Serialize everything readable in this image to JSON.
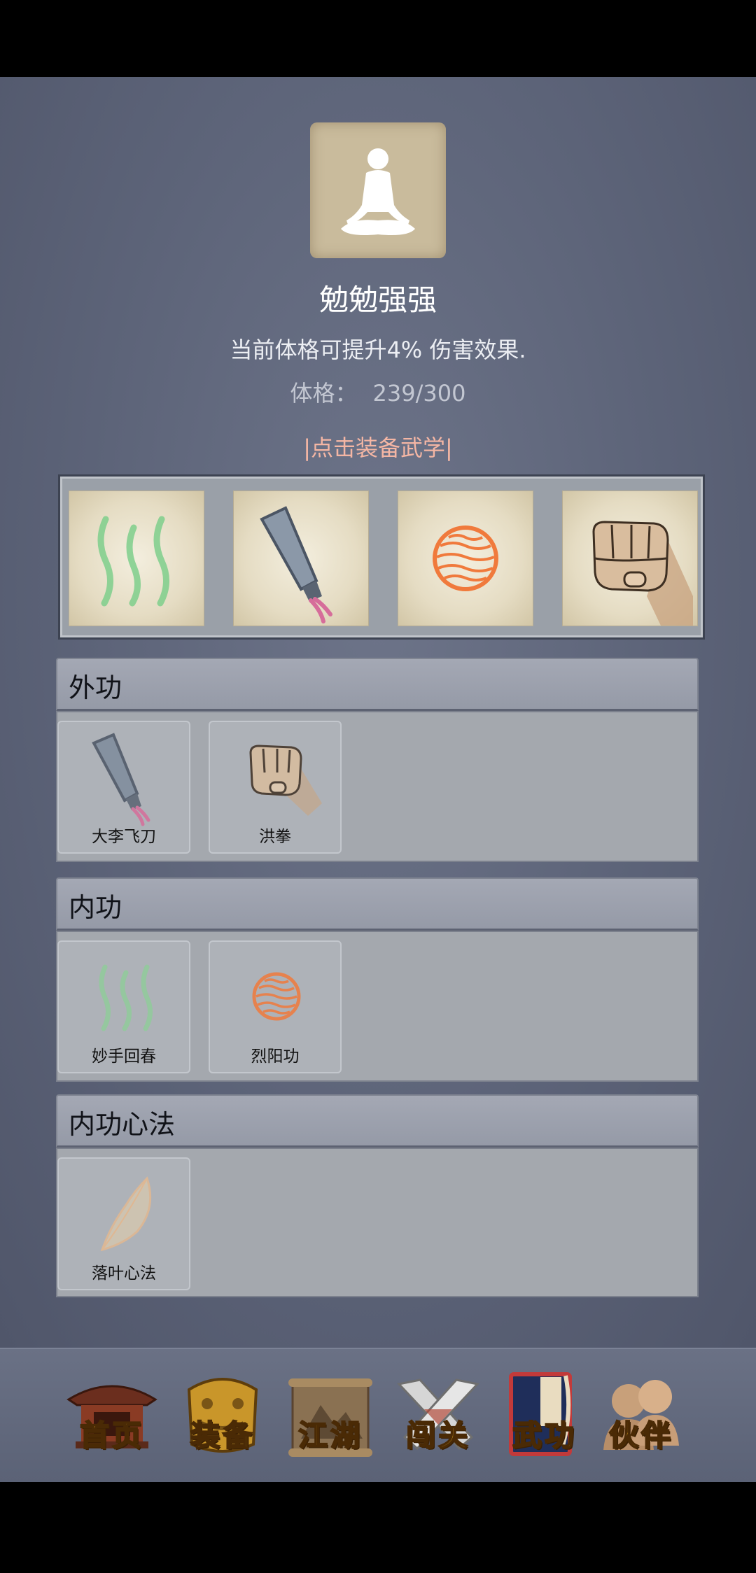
{
  "header": {
    "rank_title": "勉勉强强",
    "description": "当前体格可提升4% 伤害效果.",
    "stat_label": "体格：",
    "stat_value": "239/300",
    "equip_hint": "|点击装备武学|"
  },
  "equipped_slots": [
    {
      "icon": "green-wave-icon"
    },
    {
      "icon": "flying-knife-icon"
    },
    {
      "icon": "sun-orb-icon"
    },
    {
      "icon": "fist-icon"
    }
  ],
  "sections": {
    "outer": {
      "title": "外功",
      "items": [
        {
          "name": "大李飞刀",
          "icon": "flying-knife-icon"
        },
        {
          "name": "洪拳",
          "icon": "fist-icon"
        }
      ]
    },
    "inner": {
      "title": "内功",
      "items": [
        {
          "name": "妙手回春",
          "icon": "green-wave-icon"
        },
        {
          "name": "烈阳功",
          "icon": "sun-orb-icon"
        }
      ]
    },
    "mind": {
      "title": "内功心法",
      "items": [
        {
          "name": "落叶心法",
          "icon": "leaf-icon"
        }
      ]
    }
  },
  "nav": {
    "items": [
      {
        "label": "首页",
        "icon": "temple-icon"
      },
      {
        "label": "装备",
        "icon": "armor-icon"
      },
      {
        "label": "江湖",
        "icon": "scroll-map-icon"
      },
      {
        "label": "闯关",
        "icon": "crossed-swords-icon"
      },
      {
        "label": "武功",
        "icon": "martial-book-icon",
        "active": true
      },
      {
        "label": "伙伴",
        "icon": "partners-icon"
      }
    ]
  },
  "colors": {
    "background": "#5c6378",
    "hint": "#f4b6a4",
    "nav_label": "#f1b82b"
  }
}
